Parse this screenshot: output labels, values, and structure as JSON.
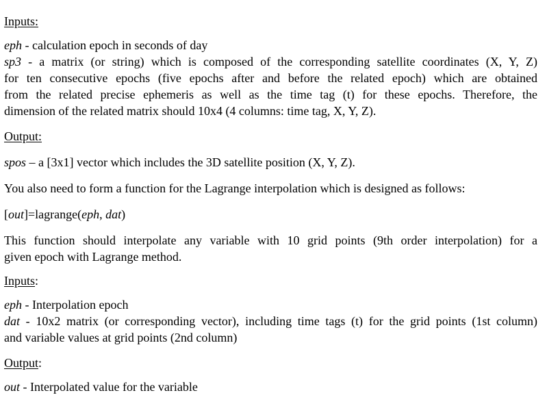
{
  "sections": {
    "inputs1": {
      "heading": "Inputs:",
      "eph_term": "eph",
      "eph_desc": " - calculation epoch in seconds of day",
      "sp3_term": "sp3",
      "sp3_line1": " - a matrix (or string) which is composed of the corresponding satellite coordinates (X, Y, Z)",
      "sp3_line2": "for ten consecutive epochs (five epochs after and before the related epoch) which are obtained",
      "sp3_line3": "from the related precise ephemeris as well as the time tag (t) for these epochs. Therefore, the",
      "sp3_line4": "dimension of the related matrix should 10x4 (4 columns: time tag, X, Y, Z)."
    },
    "output1": {
      "heading": "Output:",
      "spos_term": "spos",
      "spos_desc": " – a [3x1] vector which includes the 3D satellite position (X, Y, Z)."
    },
    "lagrange_intro": "You also need to form a function for the Lagrange interpolation which is designed as follows:",
    "signature": {
      "open": "[",
      "out": "out",
      "mid": "]=lagrange(",
      "eph": "eph",
      "comma": ", ",
      "dat": "dat",
      "close": ")"
    },
    "function_desc_line1": "This function should interpolate any variable with 10 grid points (9th order interpolation) for a",
    "function_desc_line2": "given epoch with Lagrange method.",
    "inputs2": {
      "heading_word": "Inputs",
      "heading_colon": ":",
      "eph_term": "eph",
      "eph_desc": " - Interpolation epoch",
      "dat_term": "dat",
      "dat_line1": " - 10x2 matrix (or corresponding vector), including time tags (t) for the grid points (1st column)",
      "dat_line2": "and variable values at grid points (2nd column)"
    },
    "output2": {
      "heading_word": "Output",
      "heading_colon": ":",
      "out_term": "out",
      "out_desc": " - Interpolated value for the variable"
    }
  }
}
